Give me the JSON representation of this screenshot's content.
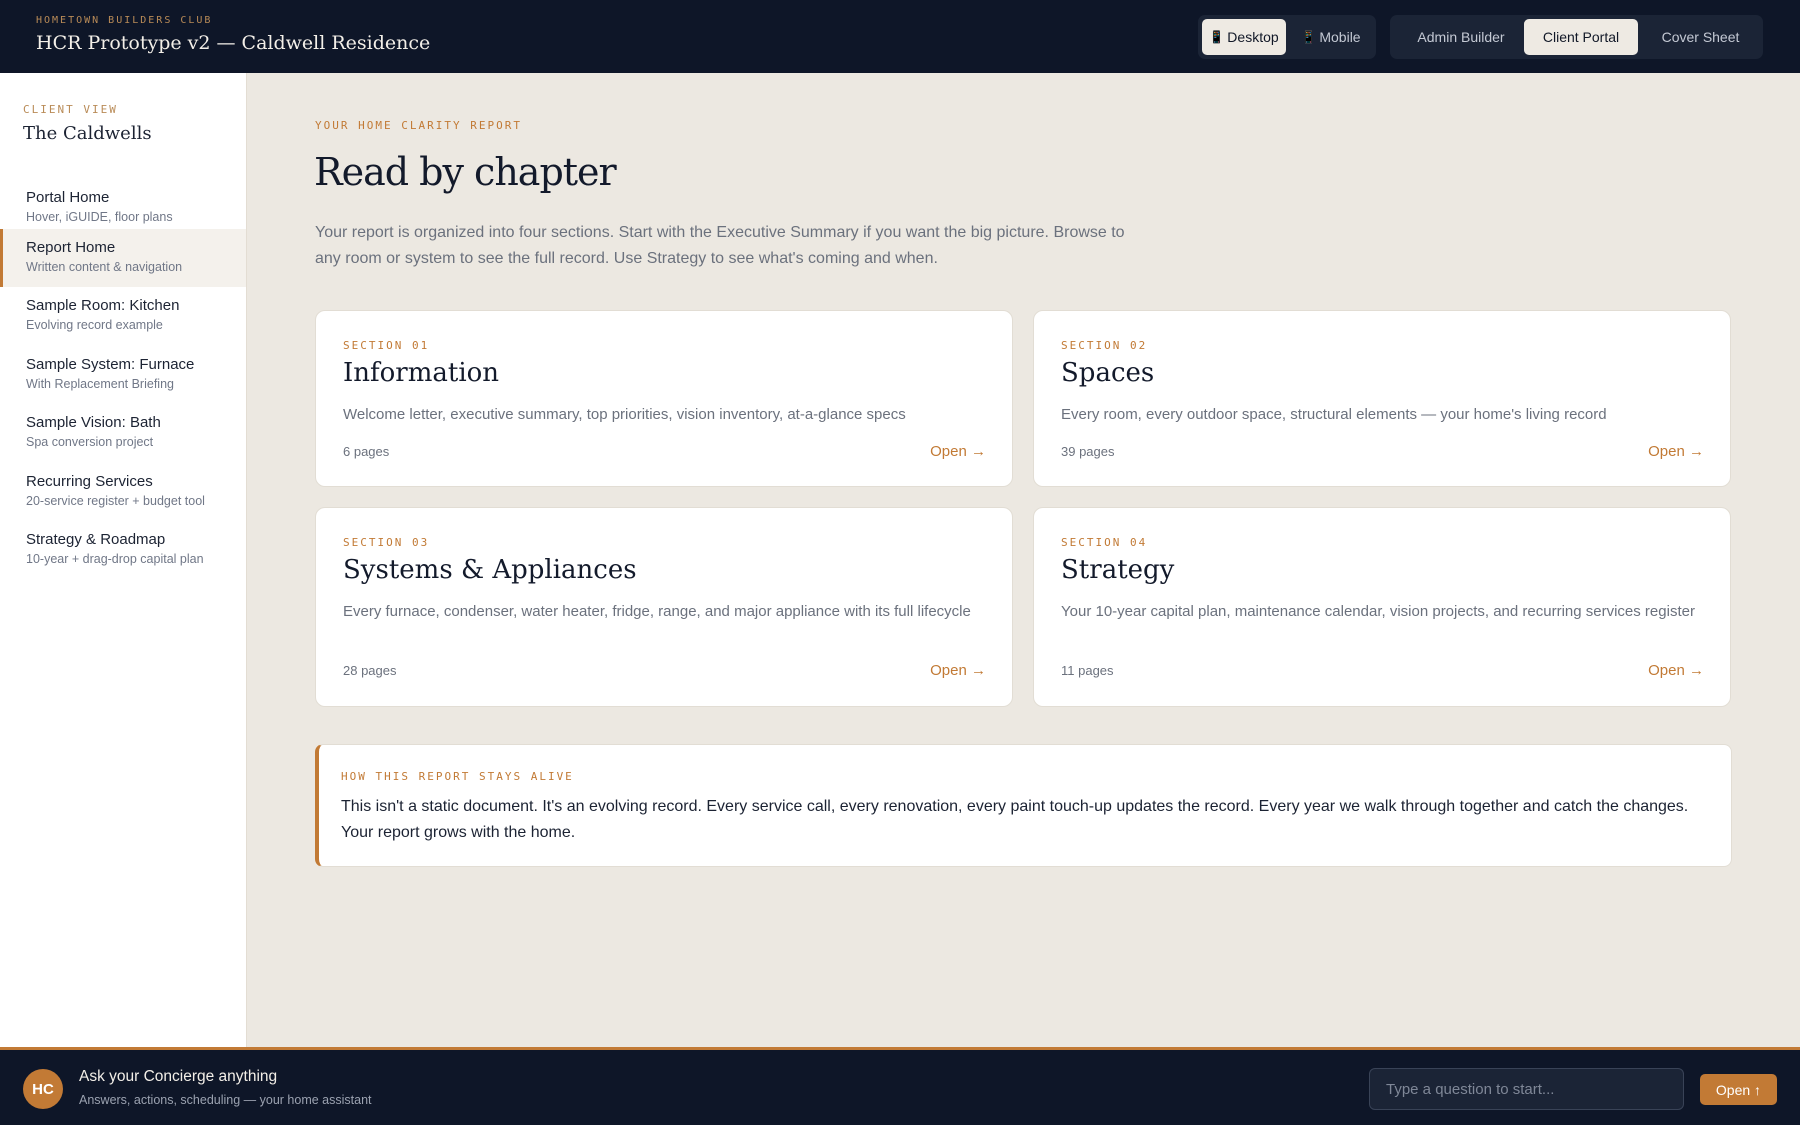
{
  "header": {
    "eyebrow": "HOMETOWN BUILDERS CLUB",
    "title": "HCR Prototype v2 — Caldwell Residence",
    "device_toggle": [
      {
        "label": "Desktop",
        "icon": "phone-icon",
        "glyph": "📱",
        "active": true
      },
      {
        "label": "Mobile",
        "icon": "phone-icon",
        "glyph": "📱",
        "active": false
      }
    ],
    "view_tabs": [
      {
        "label": "Admin Builder",
        "active": false
      },
      {
        "label": "Client Portal",
        "active": true
      },
      {
        "label": "Cover Sheet",
        "active": false
      }
    ]
  },
  "sidebar": {
    "eyebrow": "CLIENT VIEW",
    "client_name": "The Caldwells",
    "items": [
      {
        "title": "Portal Home",
        "subtitle": "Hover, iGUIDE, floor plans",
        "active": false
      },
      {
        "title": "Report Home",
        "subtitle": "Written content & navigation",
        "active": true
      },
      {
        "title": "Sample Room: Kitchen",
        "subtitle": "Evolving record example",
        "active": false
      },
      {
        "title": "Sample System: Furnace",
        "subtitle": "With Replacement Briefing",
        "active": false
      },
      {
        "title": "Sample Vision: Bath",
        "subtitle": "Spa conversion project",
        "active": false
      },
      {
        "title": "Recurring Services",
        "subtitle": "20-service register + budget tool",
        "active": false
      },
      {
        "title": "Strategy & Roadmap",
        "subtitle": "10-year + drag-drop capital plan",
        "active": false
      }
    ]
  },
  "main": {
    "eyebrow": "YOUR HOME CLARITY REPORT",
    "title": "Read by chapter",
    "intro": "Your report is organized into four sections. Start with the Executive Summary if you want the big picture. Browse to any room or system to see the full record. Use Strategy to see what's coming and when.",
    "sections": [
      {
        "eyebrow": "SECTION 01",
        "title": "Information",
        "description": "Welcome letter, executive summary, top priorities, vision inventory, at-a-glance specs",
        "pages": "6 pages",
        "open_label": "Open →"
      },
      {
        "eyebrow": "SECTION 02",
        "title": "Spaces",
        "description": "Every room, every outdoor space, structural elements — your home's living record",
        "pages": "39 pages",
        "open_label": "Open →"
      },
      {
        "eyebrow": "SECTION 03",
        "title": "Systems & Appliances",
        "description": "Every furnace, condenser, water heater, fridge, range, and major appliance with its full lifecycle",
        "pages": "28 pages",
        "open_label": "Open →"
      },
      {
        "eyebrow": "SECTION 04",
        "title": "Strategy",
        "description": "Your 10-year capital plan, maintenance calendar, vision projects, and recurring services register",
        "pages": "11 pages",
        "open_label": "Open →"
      }
    ],
    "note": {
      "eyebrow": "HOW THIS REPORT STAYS ALIVE",
      "text": "This isn't a static document. It's an evolving record. Every service call, every renovation, every paint touch-up updates the record. Every year we walk through together and catch the changes. Your report grows with the home."
    }
  },
  "concierge": {
    "avatar": "HC",
    "title": "Ask your Concierge anything",
    "subtitle": "Answers, actions, scheduling — your home assistant",
    "input_placeholder": "Type a question to start...",
    "input_value": "",
    "button_label": "Open ↑"
  },
  "colors": {
    "navy": "#0e1628",
    "accent": "#c27a35",
    "background": "#ece8e1",
    "card": "#ffffff"
  }
}
